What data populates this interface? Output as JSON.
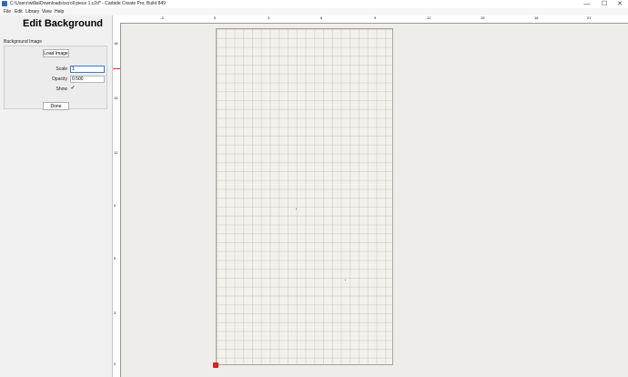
{
  "window": {
    "title": "C:\\Users\\willia\\Downloads\\scroll piece 1.c2d* - Carbide Create Pro, Build 849",
    "controls": {
      "minimize": "—",
      "maximize": "☐",
      "close": "✕"
    }
  },
  "menu": [
    "File",
    "Edit",
    "Library",
    "View",
    "Help"
  ],
  "panel": {
    "title": "Edit Background",
    "section_label": "Background Image",
    "load_button": "Load Image",
    "scale_label": "Scale",
    "scale_value": "1",
    "opacity_label": "Opacity",
    "opacity_value": "0.500",
    "show_label": "Show",
    "show_checked": "✓",
    "done_button": "Done"
  },
  "rulers": {
    "top": [
      "-3",
      "0",
      "3",
      "6",
      "9",
      "12",
      "15",
      "18",
      "21"
    ],
    "left": [
      "18",
      "15",
      "12",
      "9",
      "6",
      "3",
      "0"
    ]
  },
  "colors": {
    "accent": "#3a7bd5",
    "origin": "#d62020"
  }
}
